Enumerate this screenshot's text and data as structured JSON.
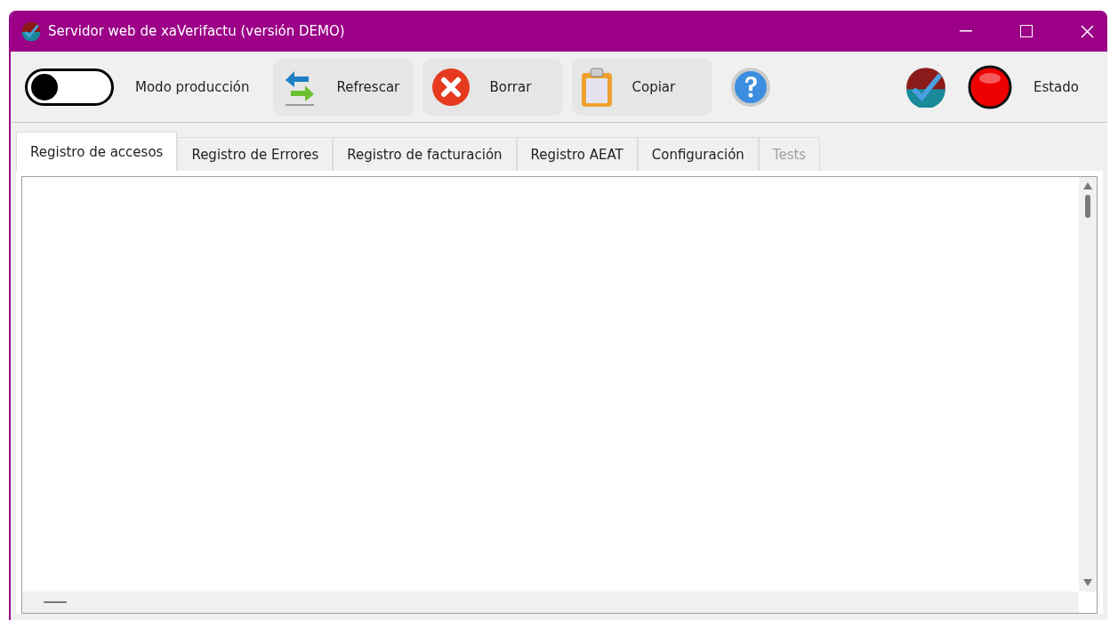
{
  "window": {
    "title": "Servidor web de xaVerifactu (versión DEMO)"
  },
  "toolbar": {
    "production_mode": {
      "label": "Modo producción",
      "on": false
    },
    "buttons": [
      {
        "kind": "refresh",
        "label": "Refrescar"
      },
      {
        "kind": "delete",
        "label": "Borrar"
      },
      {
        "kind": "copy",
        "label": "Copiar"
      },
      {
        "kind": "help"
      }
    ],
    "status": {
      "label": "Estado",
      "running": false
    }
  },
  "tabs": [
    {
      "label": "Registro de accesos",
      "selected": true,
      "disabled": false
    },
    {
      "label": "Registro de Errores",
      "selected": false,
      "disabled": false
    },
    {
      "label": "Registro de facturación",
      "selected": false,
      "disabled": false
    },
    {
      "label": "Registro AEAT",
      "selected": false,
      "disabled": false
    },
    {
      "label": "Configuración",
      "selected": false,
      "disabled": false
    },
    {
      "label": "Tests",
      "selected": false,
      "disabled": true
    }
  ]
}
